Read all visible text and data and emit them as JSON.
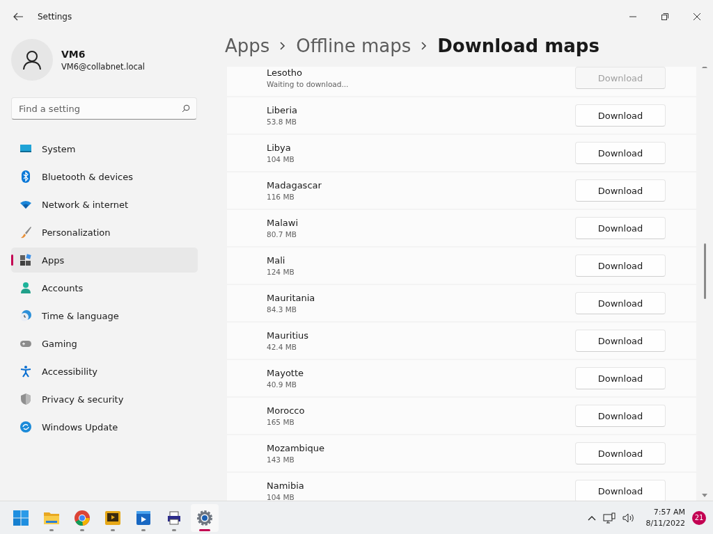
{
  "window": {
    "title": "Settings"
  },
  "user": {
    "name": "VM6",
    "email": "VM6@collabnet.local"
  },
  "search": {
    "placeholder": "Find a setting"
  },
  "sidebar": {
    "items": [
      {
        "label": "System",
        "kind": "system",
        "selected": false
      },
      {
        "label": "Bluetooth & devices",
        "kind": "bluetooth",
        "selected": false
      },
      {
        "label": "Network & internet",
        "kind": "network",
        "selected": false
      },
      {
        "label": "Personalization",
        "kind": "brush",
        "selected": false
      },
      {
        "label": "Apps",
        "kind": "apps",
        "selected": true
      },
      {
        "label": "Accounts",
        "kind": "accounts",
        "selected": false
      },
      {
        "label": "Time & language",
        "kind": "time",
        "selected": false
      },
      {
        "label": "Gaming",
        "kind": "gaming",
        "selected": false
      },
      {
        "label": "Accessibility",
        "kind": "accessibility",
        "selected": false
      },
      {
        "label": "Privacy & security",
        "kind": "privacy",
        "selected": false
      },
      {
        "label": "Windows Update",
        "kind": "update",
        "selected": false
      }
    ]
  },
  "breadcrumb": [
    "Apps",
    "Offline maps",
    "Download maps"
  ],
  "maps": [
    {
      "name": "Lesotho",
      "detail": "Waiting to download...",
      "button": "Download",
      "disabled": true
    },
    {
      "name": "Liberia",
      "detail": "53.8 MB",
      "button": "Download",
      "disabled": false
    },
    {
      "name": "Libya",
      "detail": "104 MB",
      "button": "Download",
      "disabled": false
    },
    {
      "name": "Madagascar",
      "detail": "116 MB",
      "button": "Download",
      "disabled": false
    },
    {
      "name": "Malawi",
      "detail": "80.7 MB",
      "button": "Download",
      "disabled": false
    },
    {
      "name": "Mali",
      "detail": "124 MB",
      "button": "Download",
      "disabled": false
    },
    {
      "name": "Mauritania",
      "detail": "84.3 MB",
      "button": "Download",
      "disabled": false
    },
    {
      "name": "Mauritius",
      "detail": "42.4 MB",
      "button": "Download",
      "disabled": false
    },
    {
      "name": "Mayotte",
      "detail": "40.9 MB",
      "button": "Download",
      "disabled": false
    },
    {
      "name": "Morocco",
      "detail": "165 MB",
      "button": "Download",
      "disabled": false
    },
    {
      "name": "Mozambique",
      "detail": "143 MB",
      "button": "Download",
      "disabled": false
    },
    {
      "name": "Namibia",
      "detail": "104 MB",
      "button": "Download",
      "disabled": false
    }
  ],
  "taskbar": {
    "apps": [
      {
        "kind": "start",
        "running": false,
        "active": false
      },
      {
        "kind": "folder",
        "running": true,
        "active": false
      },
      {
        "kind": "chrome",
        "running": true,
        "active": false
      },
      {
        "kind": "media",
        "running": true,
        "active": false
      },
      {
        "kind": "player",
        "running": true,
        "active": false
      },
      {
        "kind": "printer",
        "running": true,
        "active": false
      },
      {
        "kind": "settings",
        "running": true,
        "active": true
      }
    ],
    "time": "7:57 AM",
    "date": "8/11/2022",
    "badge": "21"
  }
}
